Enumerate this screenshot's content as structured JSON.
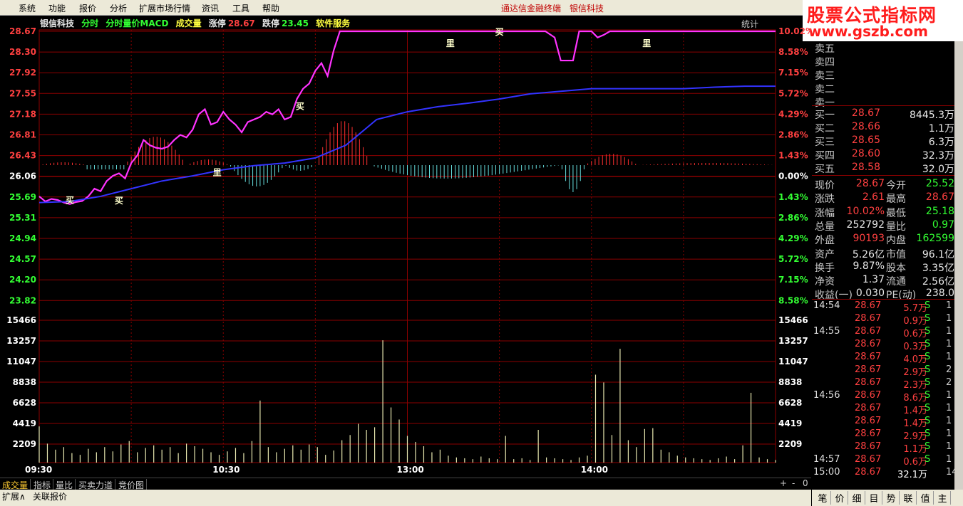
{
  "menu": {
    "items": [
      "系统",
      "功能",
      "报价",
      "分析",
      "扩展市场行情",
      "资讯",
      "工具",
      "帮助"
    ],
    "app_title": "通达信金融终端",
    "stock_title": "银信科技"
  },
  "brand": {
    "line1": "股票公式指标网",
    "line2": "www.gszb.com"
  },
  "infobar": {
    "name": "银信科技",
    "tab1": "分时",
    "tab2": "分时量价MACD",
    "tab3": "成交量",
    "limit_up_label": "涨停",
    "limit_up": "28.67",
    "limit_down_label": "跌停",
    "limit_down": "23.45",
    "industry": "软件服务",
    "stat_btn": "统计"
  },
  "colors": {
    "up": "#ff4040",
    "down": "#33ff33",
    "price_line": "#ff33ff",
    "avg_line": "#3333ff",
    "grid": "#8b0000",
    "volume": "#e8e8b0",
    "macd_pos": "#ff3030",
    "macd_neg": "#66dddd"
  },
  "chart_data": {
    "type": "line",
    "title": "",
    "price_axis": {
      "left_labels": [
        "28.67",
        "28.30",
        "27.92",
        "27.55",
        "27.18",
        "26.81",
        "26.43",
        "26.06",
        "25.69",
        "25.31",
        "24.94",
        "24.57",
        "24.20",
        "23.82"
      ],
      "right_labels": [
        "10.02%",
        "8.58%",
        "7.15%",
        "5.72%",
        "4.29%",
        "2.86%",
        "1.43%",
        "0.00%",
        "1.43%",
        "2.86%",
        "4.29%",
        "5.72%",
        "7.15%",
        "8.58%"
      ],
      "ylim": [
        23.45,
        28.67
      ],
      "prev_close": 26.06
    },
    "volume_axis": {
      "labels": [
        "15466",
        "13257",
        "11047",
        "8838",
        "6628",
        "4419",
        "2209"
      ],
      "ylim": [
        0,
        17675
      ]
    },
    "x_ticks": [
      "09:30",
      "10:30",
      "13:00",
      "14:00"
    ],
    "series": [
      {
        "name": "price",
        "x": [
          0,
          2,
          4,
          6,
          8,
          10,
          12,
          14,
          16,
          18,
          20,
          22,
          24,
          26,
          28,
          30,
          32,
          34,
          36,
          38,
          40,
          42,
          44,
          46,
          48,
          50,
          52,
          54,
          56,
          58,
          60,
          62,
          64,
          66,
          68,
          70,
          72,
          74,
          76,
          78,
          80,
          82,
          84,
          86,
          88,
          90,
          92,
          94,
          96,
          98,
          100,
          104,
          110,
          120,
          130,
          140,
          150,
          160,
          165,
          168,
          170,
          172,
          174,
          176,
          178,
          180,
          182,
          184,
          186,
          190,
          200,
          210,
          215,
          220,
          225,
          230,
          235,
          240
        ],
        "values": [
          25.45,
          25.35,
          25.4,
          25.38,
          25.33,
          25.3,
          25.34,
          25.36,
          25.45,
          25.6,
          25.55,
          25.75,
          25.85,
          25.9,
          25.8,
          26.1,
          26.25,
          26.55,
          26.45,
          26.4,
          26.38,
          26.42,
          26.55,
          26.65,
          26.6,
          26.75,
          27.05,
          27.15,
          26.85,
          26.9,
          27.1,
          26.95,
          26.85,
          26.7,
          26.9,
          26.95,
          27.0,
          27.1,
          27.05,
          27.15,
          26.95,
          27.0,
          27.35,
          27.55,
          27.65,
          27.9,
          28.05,
          27.8,
          28.3,
          28.67,
          28.67,
          28.67,
          28.67,
          28.67,
          28.67,
          28.67,
          28.67,
          28.67,
          28.67,
          28.55,
          28.1,
          28.1,
          28.1,
          28.67,
          28.67,
          28.67,
          28.55,
          28.6,
          28.67,
          28.67,
          28.67,
          28.67,
          28.67,
          28.67,
          28.67,
          28.67,
          28.67,
          28.67
        ]
      },
      {
        "name": "avg",
        "x": [
          0,
          10,
          20,
          30,
          40,
          50,
          60,
          70,
          80,
          90,
          100,
          110,
          120,
          130,
          140,
          150,
          160,
          170,
          180,
          190,
          200,
          210,
          220,
          230,
          240
        ],
        "values": [
          25.33,
          25.35,
          25.45,
          25.6,
          25.75,
          25.85,
          25.97,
          26.05,
          26.1,
          26.2,
          26.45,
          26.95,
          27.1,
          27.2,
          27.27,
          27.35,
          27.45,
          27.5,
          27.55,
          27.55,
          27.55,
          27.55,
          27.58,
          27.6,
          27.6
        ]
      }
    ],
    "volume": [
      4200,
      2200,
      1500,
      1800,
      1100,
      900,
      1600,
      1200,
      1800,
      1300,
      2100,
      2500,
      1200,
      1700,
      2000,
      1500,
      1800,
      1100,
      2200,
      1900,
      1600,
      1200,
      900,
      1300,
      1700,
      1100,
      2500,
      7200,
      1800,
      1200,
      1600,
      2000,
      1500,
      2100,
      1800,
      900,
      1400,
      2600,
      3200,
      4500,
      3800,
      4100,
      14200,
      6400,
      5000,
      3100,
      2400,
      1900,
      1200,
      1500,
      800,
      600,
      500,
      400,
      700,
      500,
      400,
      3100,
      400,
      500,
      300,
      3800,
      600,
      500,
      400,
      300,
      600,
      800,
      10200,
      9300,
      3200,
      13200,
      2600,
      1800,
      3900,
      4000,
      1500,
      1200,
      800,
      600,
      500,
      400,
      300,
      500,
      700,
      400,
      2000,
      8100,
      600,
      400,
      300
    ],
    "markers": [
      {
        "text": "买",
        "x": 10,
        "price": 25.39
      },
      {
        "text": "买",
        "x": 26,
        "price": 25.38
      },
      {
        "text": "买",
        "x": 85,
        "price": 27.22
      },
      {
        "text": "买",
        "x": 150,
        "price": 28.67
      },
      {
        "text": "里",
        "x": 58,
        "price": 25.93
      },
      {
        "text": "里",
        "x": 134,
        "price": 28.45
      },
      {
        "text": "里",
        "x": 198,
        "price": 28.45
      }
    ]
  },
  "quote": {
    "sell_labels": [
      "卖五",
      "卖四",
      "卖三",
      "卖二",
      "卖一"
    ],
    "buy": [
      {
        "label": "买一",
        "price": "28.67",
        "vol": "8445.3万"
      },
      {
        "label": "买二",
        "price": "28.66",
        "vol": "1.1万"
      },
      {
        "label": "买三",
        "price": "28.65",
        "vol": "6.3万"
      },
      {
        "label": "买四",
        "price": "28.60",
        "vol": "32.3万"
      },
      {
        "label": "买五",
        "price": "28.58",
        "vol": "32.0万"
      }
    ],
    "stats": [
      {
        "l1": "现价",
        "v1": "28.67",
        "c1": "up",
        "l2": "今开",
        "v2": "25.52",
        "c2": "dn"
      },
      {
        "l1": "涨跌",
        "v1": "2.61",
        "c1": "up",
        "l2": "最高",
        "v2": "28.67",
        "c2": "up"
      },
      {
        "l1": "涨幅",
        "v1": "10.02%",
        "c1": "up",
        "l2": "最低",
        "v2": "25.18",
        "c2": "dn"
      },
      {
        "l1": "总量",
        "v1": "252792",
        "c1": "wh",
        "l2": "量比",
        "v2": "0.97",
        "c2": "dn"
      },
      {
        "l1": "外盘",
        "v1": "90193",
        "c1": "up",
        "l2": "内盘",
        "v2": "162599",
        "c2": "dn"
      },
      {
        "l1": "资产",
        "v1": "5.26亿",
        "c1": "wh",
        "l2": "市值",
        "v2": "96.1亿",
        "c2": "wh"
      },
      {
        "l1": "换手",
        "v1": "9.87%",
        "c1": "wh",
        "l2": "股本",
        "v2": "3.35亿",
        "c2": "wh"
      },
      {
        "l1": "净资",
        "v1": "1.37",
        "c1": "wh",
        "l2": "流通",
        "v2": "2.56亿",
        "c2": "wh"
      },
      {
        "l1": "收益(一)",
        "v1": "0.030",
        "c1": "wh",
        "l2": "PE(动)",
        "v2": "238.0",
        "c2": "wh"
      }
    ],
    "ticks": [
      {
        "t": "14:54",
        "p": "28.67",
        "q": "5.7万",
        "s": "S",
        "n": "1"
      },
      {
        "t": "",
        "p": "28.67",
        "q": "0.9万",
        "s": "S",
        "n": "1"
      },
      {
        "t": "14:55",
        "p": "28.67",
        "q": "0.6万",
        "s": "S",
        "n": "1"
      },
      {
        "t": "",
        "p": "28.67",
        "q": "0.3万",
        "s": "S",
        "n": "1"
      },
      {
        "t": "",
        "p": "28.67",
        "q": "4.0万",
        "s": "S",
        "n": "1"
      },
      {
        "t": "",
        "p": "28.67",
        "q": "2.9万",
        "s": "S",
        "n": "2"
      },
      {
        "t": "",
        "p": "28.67",
        "q": "2.3万",
        "s": "S",
        "n": "2"
      },
      {
        "t": "14:56",
        "p": "28.67",
        "q": "8.6万",
        "s": "S",
        "n": "1"
      },
      {
        "t": "",
        "p": "28.67",
        "q": "1.4万",
        "s": "S",
        "n": "1"
      },
      {
        "t": "",
        "p": "28.67",
        "q": "1.4万",
        "s": "S",
        "n": "1"
      },
      {
        "t": "",
        "p": "28.67",
        "q": "2.9万",
        "s": "S",
        "n": "1"
      },
      {
        "t": "",
        "p": "28.67",
        "q": "1.1万",
        "s": "S",
        "n": "1"
      },
      {
        "t": "14:57",
        "p": "28.67",
        "q": "0.6万",
        "s": "S",
        "n": "1"
      },
      {
        "t": "15:00",
        "p": "28.67",
        "q": "32.1万",
        "s": "",
        "n": "14"
      }
    ]
  },
  "bottom_tabs": [
    "成交量",
    "指标",
    "量比",
    "买卖力道",
    "竞价图"
  ],
  "zoom_controls": [
    "+",
    "-",
    "0"
  ],
  "status_items": [
    "扩展∧",
    "关联报价"
  ],
  "side_tabs": [
    "笔",
    "价",
    "细",
    "目",
    "势",
    "联",
    "值",
    "主"
  ]
}
